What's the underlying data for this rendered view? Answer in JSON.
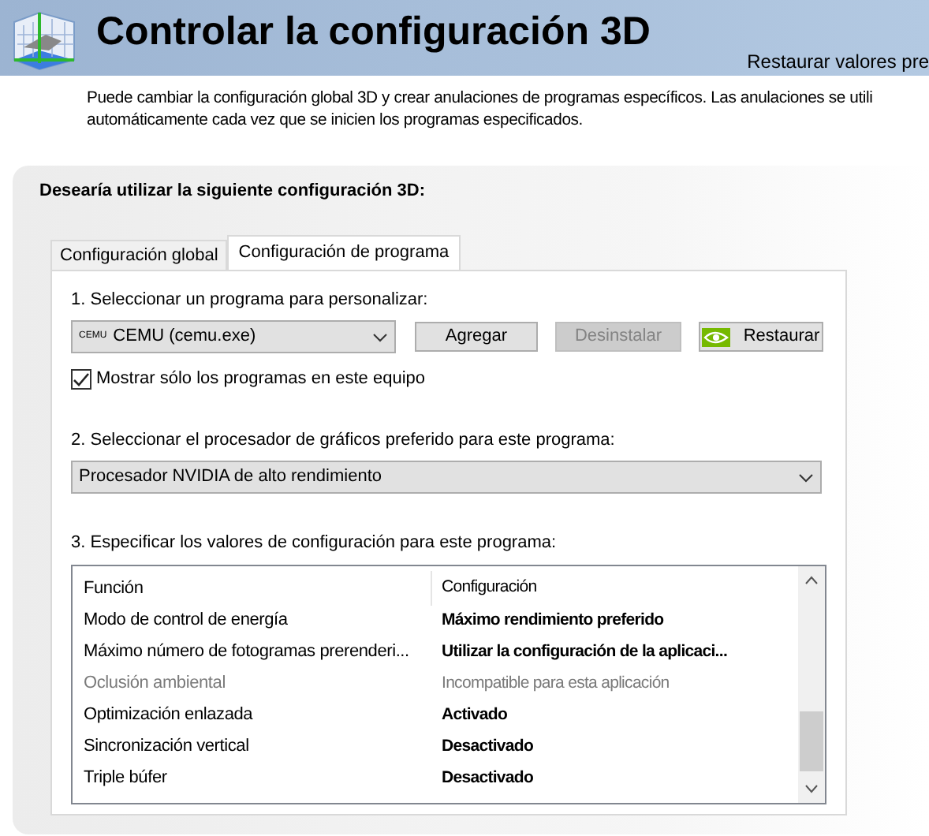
{
  "header": {
    "title": "Controlar la configuración 3D",
    "link": "Restaurar valores pre"
  },
  "description": [
    "Puede cambiar la configuración global 3D y crear anulaciones de programas específicos. Las anulaciones se utili",
    "automáticamente cada vez que se inicien los programas especificados."
  ],
  "panel": {
    "heading": "Desearía utilizar la siguiente configuración 3D:",
    "tabs": [
      {
        "label": "Configuración global",
        "selected": false
      },
      {
        "label": "Configuración de programa",
        "selected": true
      }
    ],
    "step1": {
      "label": "1. Seleccionar un programa para personalizar:",
      "program_icon": "CEMU",
      "program": "CEMU (cemu.exe)",
      "buttons": [
        {
          "label": "Agregar",
          "disabled": false,
          "kind": "plain"
        },
        {
          "label": "Desinstalar",
          "disabled": true,
          "kind": "plain"
        },
        {
          "label": "Restaurar",
          "disabled": false,
          "kind": "nvidia"
        }
      ],
      "checkbox": {
        "label": "Mostrar sólo los programas en este equipo",
        "checked": true
      }
    },
    "step2": {
      "label": "2. Seleccionar el procesador de gráficos preferido para este programa:",
      "value": "Procesador NVIDIA de alto rendimiento"
    },
    "step3": {
      "label": "3. Especificar los valores de configuración para este programa:",
      "columns": [
        "Función",
        "Configuración"
      ],
      "rows": [
        {
          "feature": "Modo de control de energía",
          "setting": "Máximo rendimiento preferido",
          "disabled": false
        },
        {
          "feature": "Máximo número de fotogramas prerenderi...",
          "setting": "Utilizar la configuración de la aplicaci...",
          "disabled": false
        },
        {
          "feature": "Oclusión ambiental",
          "setting": "Incompatible para esta aplicación",
          "disabled": true
        },
        {
          "feature": "Optimización enlazada",
          "setting": "Activado",
          "disabled": false
        },
        {
          "feature": "Sincronización vertical",
          "setting": "Desactivado",
          "disabled": false
        },
        {
          "feature": "Triple búfer",
          "setting": "Desactivado",
          "disabled": false
        }
      ]
    }
  }
}
